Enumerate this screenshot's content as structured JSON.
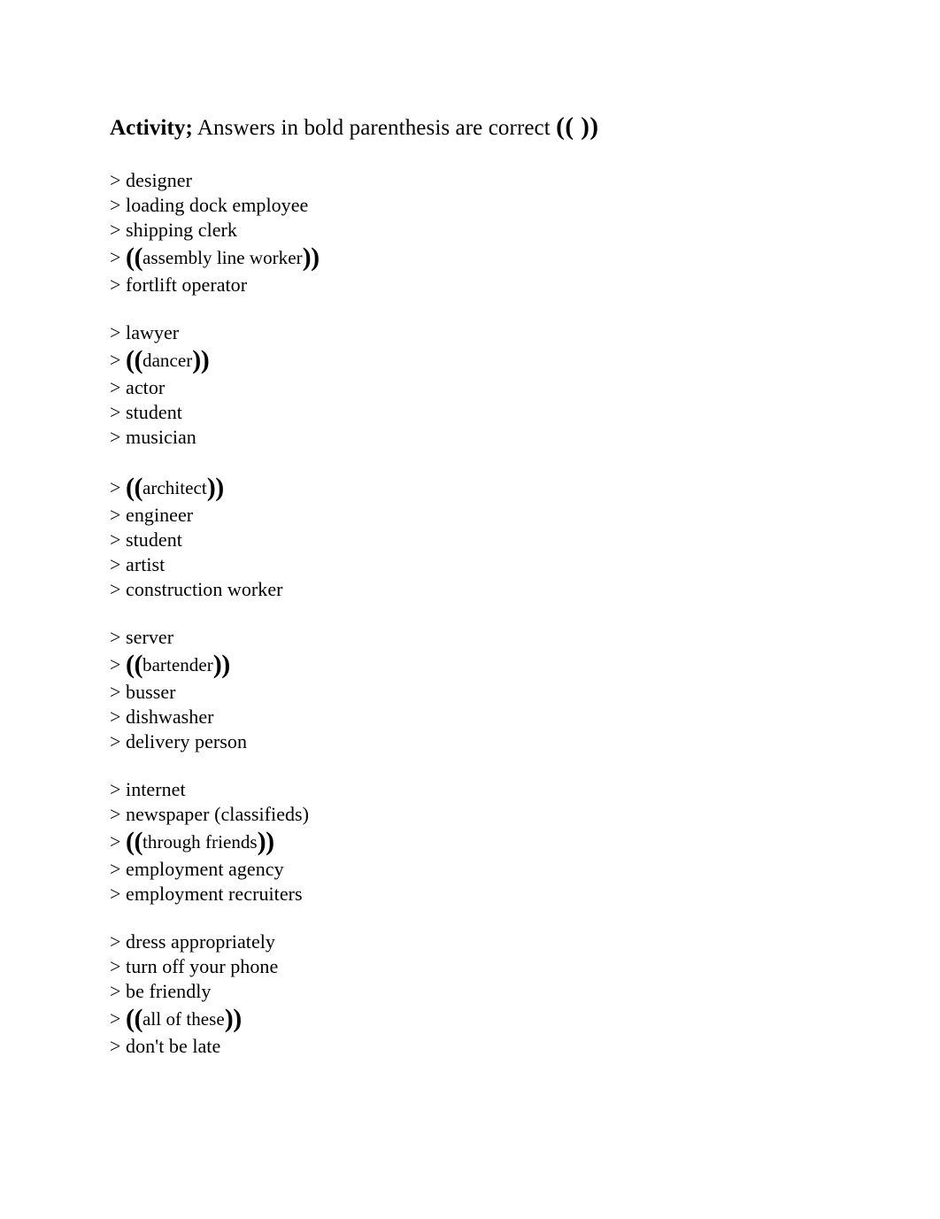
{
  "document": {
    "title": {
      "strong": "Activity;",
      "rest": "Answers in bold parenthesis are correct",
      "parens": "(( ))"
    },
    "bullet_marker": ">",
    "open_paren": "((",
    "close_paren": "))",
    "groups": [
      {
        "options": [
          {
            "text": "designer",
            "answer": false
          },
          {
            "text": "loading dock employee",
            "answer": false
          },
          {
            "text": "shipping clerk",
            "answer": false
          },
          {
            "text": "assembly line worker",
            "answer": true
          },
          {
            "text": "fortlift operator",
            "answer": false
          }
        ]
      },
      {
        "options": [
          {
            "text": "lawyer",
            "answer": false
          },
          {
            "text": "dancer",
            "answer": true
          },
          {
            "text": "actor",
            "answer": false
          },
          {
            "text": "student",
            "answer": false
          },
          {
            "text": "musician",
            "answer": false
          }
        ]
      },
      {
        "options": [
          {
            "text": "architect",
            "answer": true
          },
          {
            "text": "engineer",
            "answer": false
          },
          {
            "text": "student",
            "answer": false
          },
          {
            "text": "artist",
            "answer": false
          },
          {
            "text": "construction worker",
            "answer": false
          }
        ]
      },
      {
        "options": [
          {
            "text": "server",
            "answer": false
          },
          {
            "text": "bartender",
            "answer": true
          },
          {
            "text": "busser",
            "answer": false
          },
          {
            "text": "dishwasher",
            "answer": false
          },
          {
            "text": "delivery person",
            "answer": false
          }
        ]
      },
      {
        "options": [
          {
            "text": "internet",
            "answer": false
          },
          {
            "text": "newspaper (classifieds)",
            "answer": false
          },
          {
            "text": "through friends",
            "answer": true
          },
          {
            "text": "employment agency",
            "answer": false
          },
          {
            "text": "employment recruiters",
            "answer": false
          }
        ]
      },
      {
        "options": [
          {
            "text": "dress appropriately",
            "answer": false
          },
          {
            "text": "turn off your phone",
            "answer": false
          },
          {
            "text": "be friendly",
            "answer": false
          },
          {
            "text": "all of these",
            "answer": true
          },
          {
            "text": "don't be late",
            "answer": false
          }
        ]
      }
    ]
  }
}
